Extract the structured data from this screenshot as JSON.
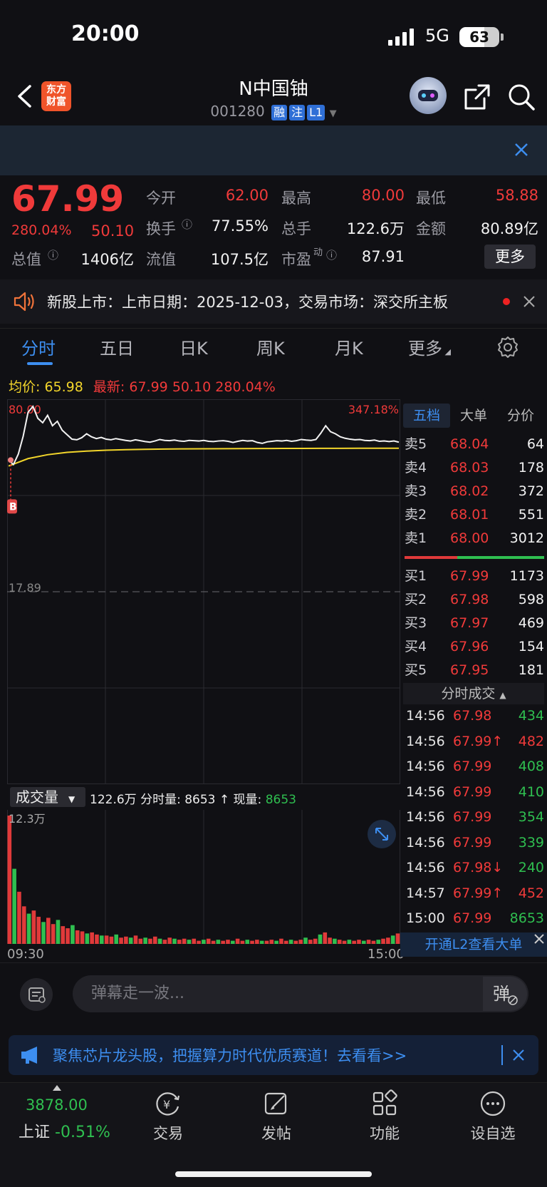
{
  "status": {
    "time": "20:00",
    "network": "5G",
    "battery": "63",
    "battery_level": 0.63
  },
  "nav": {
    "logo_line1": "东方",
    "logo_line2": "财富",
    "title": "N中国铀",
    "code": "001280",
    "tags": [
      "融",
      "注",
      "L1"
    ]
  },
  "quote": {
    "price": "67.99",
    "pct": "280.04%",
    "change": "50.10",
    "rows": [
      [
        {
          "label": "今开",
          "value": "62.00",
          "color": "red"
        },
        {
          "label": "最高",
          "value": "80.00",
          "color": "red"
        },
        {
          "label": "最低",
          "value": "58.88",
          "color": "red"
        }
      ],
      [
        {
          "label": "换手",
          "value": "77.55%",
          "color": "white"
        },
        {
          "label": "总手",
          "value": "122.6万",
          "color": "white"
        },
        {
          "label": "金额",
          "value": "80.89亿",
          "color": "white"
        }
      ],
      [
        {
          "label": "总值",
          "value": "1406亿",
          "color": "white"
        },
        {
          "label": "流值",
          "value": "107.5亿",
          "color": "white"
        },
        {
          "label": "市盈",
          "sup": "动",
          "value": "87.91",
          "color": "white"
        }
      ]
    ],
    "more": "更多"
  },
  "notice": {
    "text": "新股上市：上市日期：2025-12-03，交易市场：深交所主板"
  },
  "tabs": [
    "分时",
    "五日",
    "日K",
    "周K",
    "月K",
    "更多"
  ],
  "avg_row": {
    "avg_label": "均价:",
    "avg_value": "65.98",
    "latest_label": "最新:",
    "latest_price": "67.99",
    "latest_change": "50.10",
    "latest_pct": "280.04%"
  },
  "chart_data": {
    "type": "line",
    "x_start": "09:30",
    "x_end": "15:00",
    "y_top_label": "80.00",
    "y_top_pct": "347.18%",
    "y_mid_label": "17.89",
    "buy_marker": "B",
    "ylim": [
      -44.22,
      80.0
    ],
    "price_series": [
      62.0,
      60.5,
      64.0,
      70.0,
      78.0,
      80.0,
      76.0,
      74.5,
      77.0,
      73.5,
      75.0,
      72.0,
      70.5,
      69.0,
      68.8,
      69.5,
      70.8,
      69.8,
      69.2,
      69.6,
      69.0,
      68.8,
      69.2,
      68.9,
      68.6,
      68.4,
      68.8,
      68.5,
      68.2,
      68.0,
      68.4,
      68.9,
      68.6,
      68.5,
      68.7,
      68.4,
      68.3,
      68.6,
      68.5,
      68.4,
      68.6,
      68.3,
      68.2,
      68.4,
      68.5,
      68.3,
      67.9,
      68.3,
      68.6,
      68.4,
      68.5,
      67.9,
      67.6,
      68.1,
      68.3,
      68.5,
      68.4,
      68.6,
      68.3,
      68.5,
      68.9,
      68.7,
      68.6,
      68.9,
      71.0,
      73.5,
      71.5,
      70.8,
      69.8,
      69.3,
      69.0,
      68.8,
      68.9,
      68.6,
      68.5,
      68.7,
      68.3,
      68.4,
      68.2,
      68.4,
      67.99
    ],
    "avg_series": [
      60.0,
      62.5,
      63.8,
      64.6,
      65.0,
      65.3,
      65.5,
      65.6,
      65.7,
      65.75,
      65.8,
      65.82,
      65.85,
      65.87,
      65.9,
      65.92,
      65.94,
      65.95,
      65.96,
      65.97,
      65.98
    ],
    "volume_label": "成交量",
    "volume_summary": "122.6万",
    "minute_vol_label": "分时量:",
    "minute_vol": "8653",
    "current_vol_label": "现量:",
    "current_vol": "8653",
    "volume_max_label": "12.3万",
    "volume": [
      12.3,
      7.2,
      5.0,
      3.6,
      2.9,
      3.2,
      2.6,
      2.1,
      2.5,
      1.9,
      2.3,
      1.7,
      1.5,
      1.8,
      1.3,
      1.2,
      1.0,
      1.1,
      0.9,
      0.8,
      0.8,
      0.7,
      0.9,
      0.6,
      0.7,
      0.6,
      0.8,
      0.5,
      0.6,
      0.5,
      0.7,
      0.5,
      0.4,
      0.6,
      0.5,
      0.4,
      0.5,
      0.4,
      0.5,
      0.3,
      0.4,
      0.5,
      0.3,
      0.4,
      0.3,
      0.4,
      0.3,
      0.5,
      0.3,
      0.4,
      0.3,
      0.4,
      0.3,
      0.3,
      0.4,
      0.3,
      0.5,
      0.3,
      0.4,
      0.3,
      0.4,
      0.6,
      0.4,
      0.5,
      0.9,
      1.1,
      0.6,
      0.5,
      0.4,
      0.3,
      0.4,
      0.3,
      0.4,
      0.3,
      0.4,
      0.3,
      0.4,
      0.5,
      0.6,
      0.8,
      1.0
    ]
  },
  "order_book": {
    "tabs": [
      "五档",
      "大单",
      "分价"
    ],
    "asks": [
      {
        "label": "卖5",
        "price": "68.04",
        "vol": "64"
      },
      {
        "label": "卖4",
        "price": "68.03",
        "vol": "178"
      },
      {
        "label": "卖3",
        "price": "68.02",
        "vol": "372"
      },
      {
        "label": "卖2",
        "price": "68.01",
        "vol": "551"
      },
      {
        "label": "卖1",
        "price": "68.00",
        "vol": "3012"
      }
    ],
    "bids": [
      {
        "label": "买1",
        "price": "67.99",
        "vol": "1173"
      },
      {
        "label": "买2",
        "price": "67.98",
        "vol": "598"
      },
      {
        "label": "买3",
        "price": "67.97",
        "vol": "469"
      },
      {
        "label": "买4",
        "price": "67.96",
        "vol": "154"
      },
      {
        "label": "买5",
        "price": "67.95",
        "vol": "181"
      }
    ]
  },
  "ticks": {
    "title": "分时成交",
    "rows": [
      {
        "time": "14:56",
        "price": "67.98",
        "vol": "434",
        "dir": "sell"
      },
      {
        "time": "14:56",
        "price": "67.99↑",
        "vol": "482",
        "dir": "buy"
      },
      {
        "time": "14:56",
        "price": "67.99",
        "vol": "408",
        "dir": "sell"
      },
      {
        "time": "14:56",
        "price": "67.99",
        "vol": "410",
        "dir": "sell"
      },
      {
        "time": "14:56",
        "price": "67.99",
        "vol": "354",
        "dir": "sell"
      },
      {
        "time": "14:56",
        "price": "67.99",
        "vol": "339",
        "dir": "sell"
      },
      {
        "time": "14:56",
        "price": "67.98↓",
        "vol": "240",
        "dir": "sell"
      },
      {
        "time": "14:57",
        "price": "67.99↑",
        "vol": "452",
        "dir": "buy"
      },
      {
        "time": "15:00",
        "price": "67.99",
        "vol": "8653",
        "dir": "sell"
      }
    ],
    "l2_banner": "开通L2查看大单"
  },
  "comment": {
    "placeholder": "弹幕走一波..."
  },
  "promo": {
    "text": "聚焦芯片龙头股，把握算力时代优质赛道！去看看>>"
  },
  "bottom_nav": {
    "index_value": "3878.00",
    "index_name": "上证",
    "index_change": "-0.51%",
    "items": [
      "交易",
      "发帖",
      "功能",
      "设自选"
    ]
  },
  "colors": {
    "up": "#f03a3a",
    "down": "#2fbf50",
    "accent": "#3d8ef0",
    "avg_line": "#f2d52b"
  }
}
